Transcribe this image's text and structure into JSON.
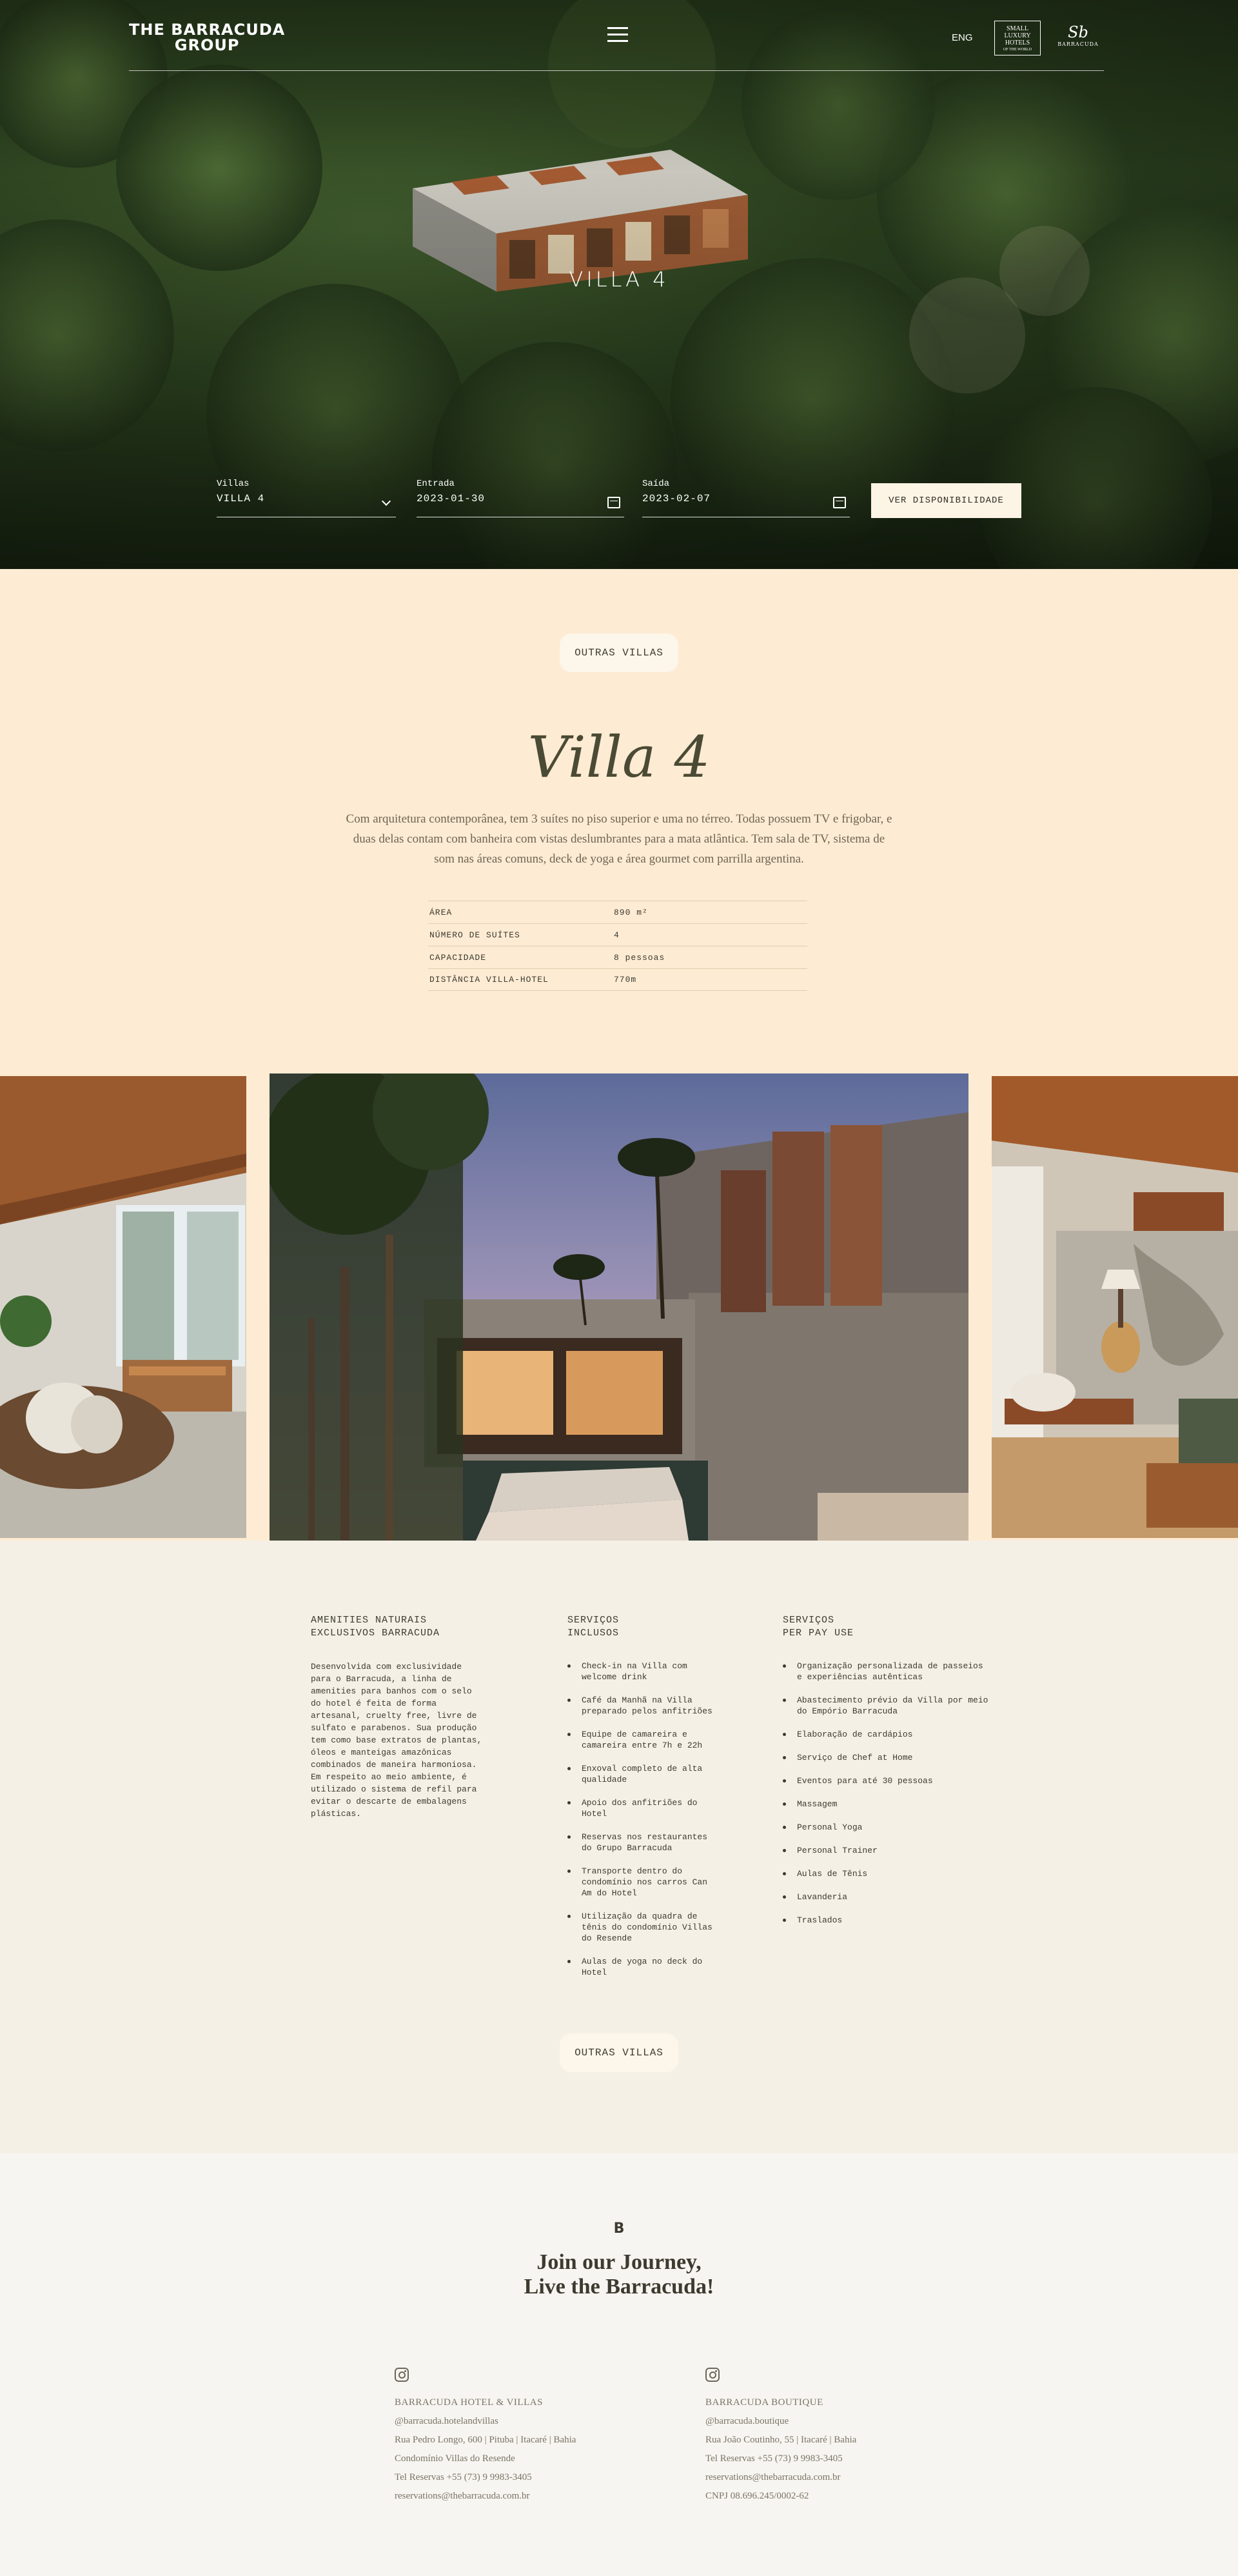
{
  "header": {
    "logo_line1": "THE BARRACUDA",
    "logo_line2": "GROUP",
    "menu_icon": "hamburger-icon",
    "language": "ENG",
    "badge_slh": [
      "SMALL",
      "LUXURY",
      "HOTELS",
      "OF THE WORLD"
    ],
    "badge_sb": {
      "main": "Sb",
      "sub": "BARRACUDA"
    }
  },
  "hero": {
    "title": "VILLA 4"
  },
  "booking": {
    "villa_label": "Villas",
    "villa_value": "VILLA 4",
    "checkin_label": "Entrada",
    "checkin_value": "2023-01-30",
    "checkout_label": "Saída",
    "checkout_value": "2023-02-07",
    "button": "VER DISPONIBILIDADE"
  },
  "intro": {
    "other_villas": "OUTRAS VILLAS",
    "title": "Villa 4",
    "description": "Com arquitetura contemporânea, tem 3 suítes no piso superior e uma no térreo. Todas possuem TV e frigobar, e duas delas contam com banheira com vistas deslumbrantes para a mata atlântica. Tem sala de TV, sistema de som nas áreas comuns, deck de yoga e área gourmet com parrilla argentina.",
    "specs": [
      {
        "key": "ÁREA",
        "value": "890 m²"
      },
      {
        "key": "NÚMERO DE SUÍTES",
        "value": "4"
      },
      {
        "key": "CAPACIDADE",
        "value": "8 pessoas"
      },
      {
        "key": "DISTÂNCIA VILLA-HOTEL",
        "value": "770m"
      }
    ]
  },
  "amenities": {
    "col1": {
      "title1": "AMENITIES NATURAIS",
      "title2": "EXCLUSIVOS BARRACUDA",
      "text": "Desenvolvida com exclusividade para o Barracuda, a linha de amenities para banhos com o selo do hotel é feita de forma artesanal, cruelty free, livre de sulfato e parabenos. Sua produção tem como base extratos de plantas, óleos e manteigas amazônicas combinados de maneira harmoniosa. Em respeito ao meio ambiente, é utilizado o sistema de refil para evitar o descarte de embalagens plásticas."
    },
    "col2": {
      "title1": "SERVIÇOS",
      "title2": "INCLUSOS",
      "items": [
        "Check-in na Villa com welcome drink",
        "Café da Manhã na Villa preparado pelos anfitriões",
        "Equipe de camareira e camareira entre 7h e 22h",
        "Enxoval completo de alta qualidade",
        "Apoio dos anfitriões do Hotel",
        "Reservas nos restaurantes do Grupo Barracuda",
        "Transporte dentro do condomínio nos carros Can Am do Hotel",
        "Utilização da quadra de tênis do condomínio Villas do Resende",
        "Aulas de yoga no deck do Hotel"
      ]
    },
    "col3": {
      "title1": "SERVIÇOS",
      "title2": "PER PAY USE",
      "items": [
        "Organização personalizada de passeios e experiências autênticas",
        "Abastecimento prévio da Villa por meio do Empório Barracuda",
        "Elaboração de cardápios",
        "Serviço de Chef at Home",
        "Eventos para até 30 pessoas",
        "Massagem",
        "Personal Yoga",
        "Personal Trainer",
        "Aulas de Tênis",
        "Lavanderia",
        "Traslados"
      ]
    },
    "other_villas": "OUTRAS VILLAS"
  },
  "footer": {
    "mark": "B",
    "join_line1": "Join our Journey,",
    "join_line2": "Live the Barracuda!",
    "hotel": {
      "icon": "instagram-icon",
      "title": "BARRACUDA HOTEL & VILLAS",
      "handle": "@barracuda.hotelandvillas",
      "address": "Rua Pedro Longo, 600 | Pituba | Itacaré | Bahia",
      "condo": "Condomínio Villas do Resende",
      "phone": "Tel Reservas +55 (73) 9 9983-3405",
      "email": "reservations@thebarracuda.com.br"
    },
    "boutique": {
      "icon": "instagram-icon",
      "title": "BARRACUDA BOUTIQUE",
      "handle": "@barracuda.boutique",
      "address": "Rua João Coutinho, 55 | Itacaré | Bahia",
      "phone": "Tel Reservas +55 (73) 9 9983-3405",
      "email": "reservations@thebarracuda.com.br",
      "cnpj": "CNPJ 08.696.245/0002-62"
    }
  },
  "colors": {
    "cream": "#fdebd3",
    "olive": "#4b4a34",
    "ink": "#3d3a2f",
    "amenities_bg": "#f4f0e6"
  }
}
